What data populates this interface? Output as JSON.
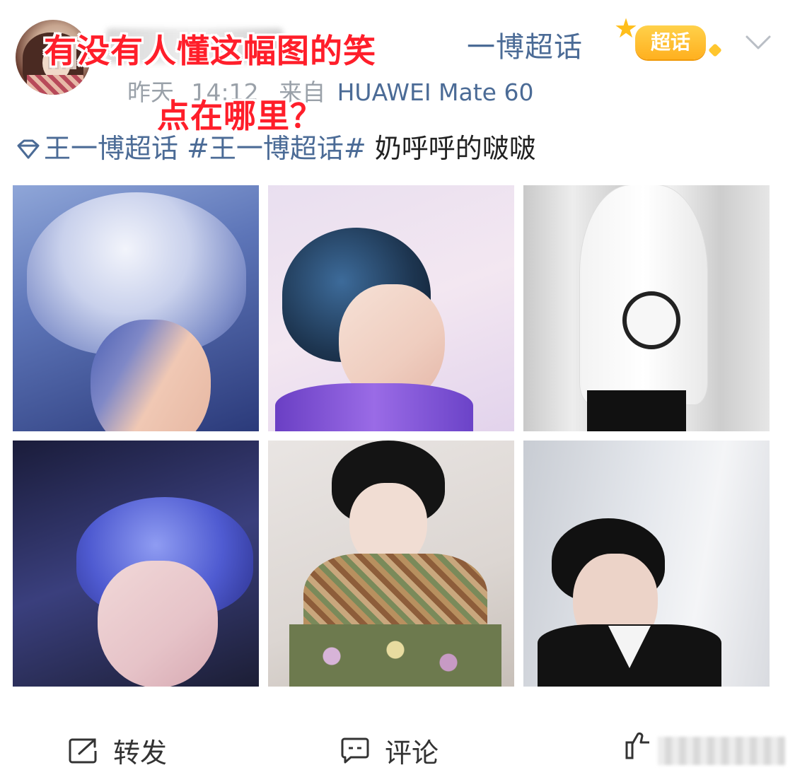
{
  "header": {
    "username_visible_tail": "一博超话",
    "time_text": "昨天",
    "time_clock": "14:12",
    "source_prefix": "来自",
    "source_device": "HUAWEI Mate 60",
    "badge_label": "超话"
  },
  "overlay_caption": {
    "line1": "有没有人懂这幅图的笑",
    "line2": "点在哪里？",
    "color": "#ff1e2a"
  },
  "post": {
    "topic_link": "王一博超话",
    "hashtag": "#王一博超话#",
    "body": "奶呼呼的啵啵"
  },
  "photos": [
    {
      "name": "silver-hair-closeup"
    },
    {
      "name": "blue-hair-side-profile"
    },
    {
      "name": "white-hoodie-outfit"
    },
    {
      "name": "blue-hair-stage"
    },
    {
      "name": "floral-jacket-portrait"
    },
    {
      "name": "black-suit-portrait"
    }
  ],
  "actions": {
    "repost_label": "转发",
    "comment_label": "评论"
  },
  "colors": {
    "link": "#4b6b96",
    "meta": "#9aa1a9",
    "badge": "#ffb01f"
  }
}
